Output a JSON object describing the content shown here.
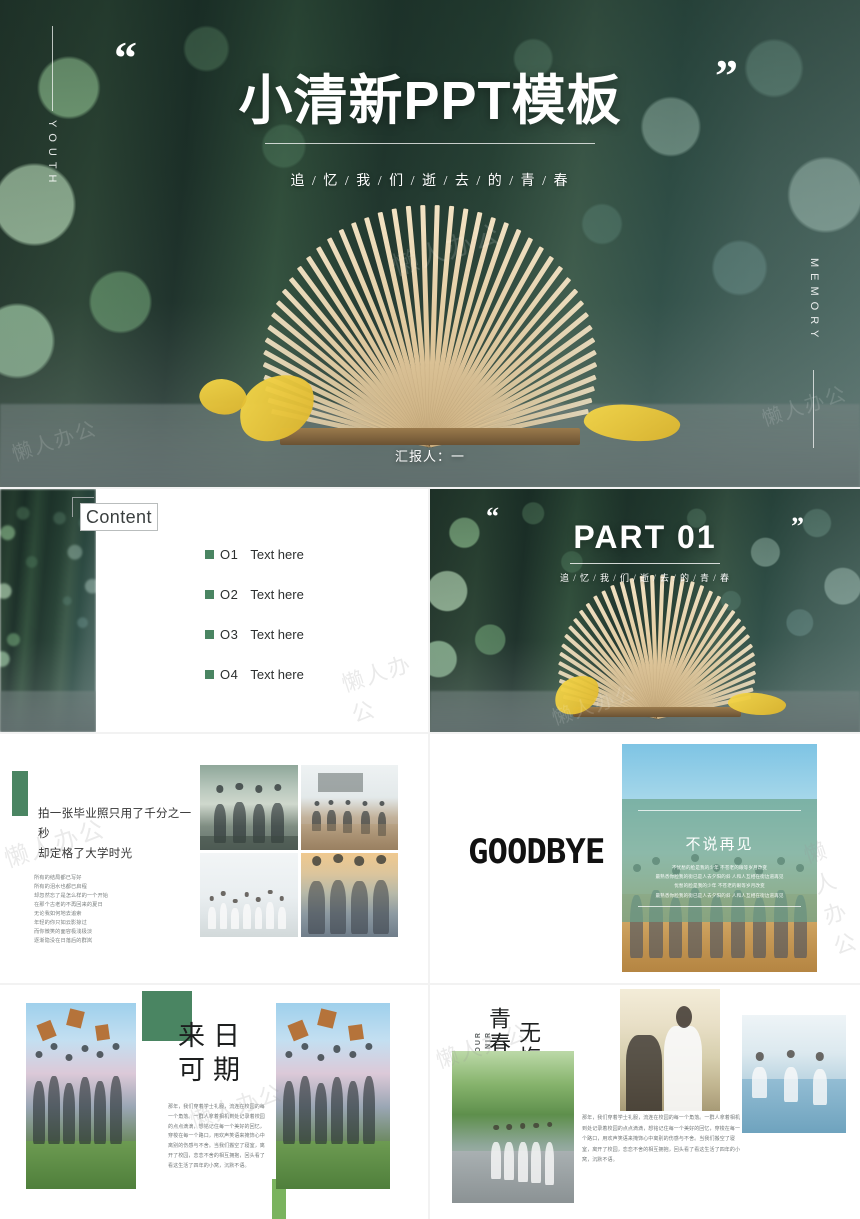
{
  "deck": {
    "watermark": "懒人办公"
  },
  "title_slide": {
    "side_left_label": "YOUTH",
    "side_right_label": "MEMORY",
    "quote_open": "“",
    "quote_close": "”",
    "title": "小清新PPT模板",
    "subtitle": "追 / 忆 / 我 / 们 / 逝 / 去 / 的 / 青 / 春",
    "presenter": "汇报人：一"
  },
  "content_slide": {
    "heading": "Content",
    "items": [
      {
        "num": "O1",
        "text": "Text here"
      },
      {
        "num": "O2",
        "text": "Text here"
      },
      {
        "num": "O3",
        "text": "Text here"
      },
      {
        "num": "O4",
        "text": "Text here"
      }
    ],
    "accent_color": "#4a8562"
  },
  "part_slide": {
    "quote_open": "“",
    "quote_close": "”",
    "title": "PART 01",
    "subtitle": "追 / 忆 / 我 / 们 / 逝 / 去 / 的 / 青 / 春"
  },
  "grad_slide": {
    "headline": "拍一张毕业照只用了千分之一秒\n却定格了大学时光",
    "body": "所有的结局都已写好\n所有的泪水也都已启程\n却忽然忘了是怎么样的一个开始\n在那个古老的不再回来的夏日\n无论我如何地去追索\n年轻的你只如云影掠过\n而你微笑的面容极浅极淡\n逐渐隐没在日落后的群岚",
    "accent_color": "#4a8562",
    "photos": [
      "gym-jump-photo",
      "classroom-photo",
      "studio-group-photo",
      "sunset-friends-photo"
    ]
  },
  "goodbye_slide": {
    "word": "GOODBYE",
    "card_title": "不说再见",
    "card_body": "不忧愁的脸是我的少年 不苍老的眼等岁月改变\n最熟悉你脸我的街已是人去夕阳的斜  人和人互相在街边道再见\n忧愁的脸是我的少年 不苍老的眼等岁月改变\n最熟悉你脸我的街已是人去夕阳的斜  人和人互相在街边道再见",
    "card_tint_color": "#6ca38c"
  },
  "future_slide": {
    "title": "来日\n可期",
    "body": "那年，我们穿着学士礼服，流连在校园的每一个角落。一群人拿着相机到处记录着校园的点点滴滴，想铭记住每一个美好的回忆，穿梭在每一个路口，用欢声笑语来掩饰心中离别的伤感与不舍。当我们搬空了寝室，离开了校园，恋恋不舍的相互拥抱，回头看了看这生活了四年的小窝，沉默不语。",
    "accent_color": "#4a8562",
    "photos": [
      "graduation-cap-toss-photo-left",
      "graduation-cap-toss-photo-right"
    ]
  },
  "youth_slide": {
    "title_part1": "青春",
    "title_part2": "无悔",
    "vertical_en_1": "YOUR",
    "vertical_en_2": "SOUVENIR",
    "body": "那年，我们穿着学士礼服，流连在校园的每一个角落。一群人拿着相机到处记录着校园的点点滴滴，想铭记住每一个美好的回忆，穿梭在每一个路口，用欢声笑语来掩饰心中离别的伤感与不舍。当我们搬空了寝室，离开了校园，恋恋不舍的相互拥抱，回头看了看这生活了四年的小窝，沉默不语。",
    "photos": [
      "tree-lined-street-photo",
      "students-talking-photo",
      "lecture-hall-photo"
    ]
  }
}
